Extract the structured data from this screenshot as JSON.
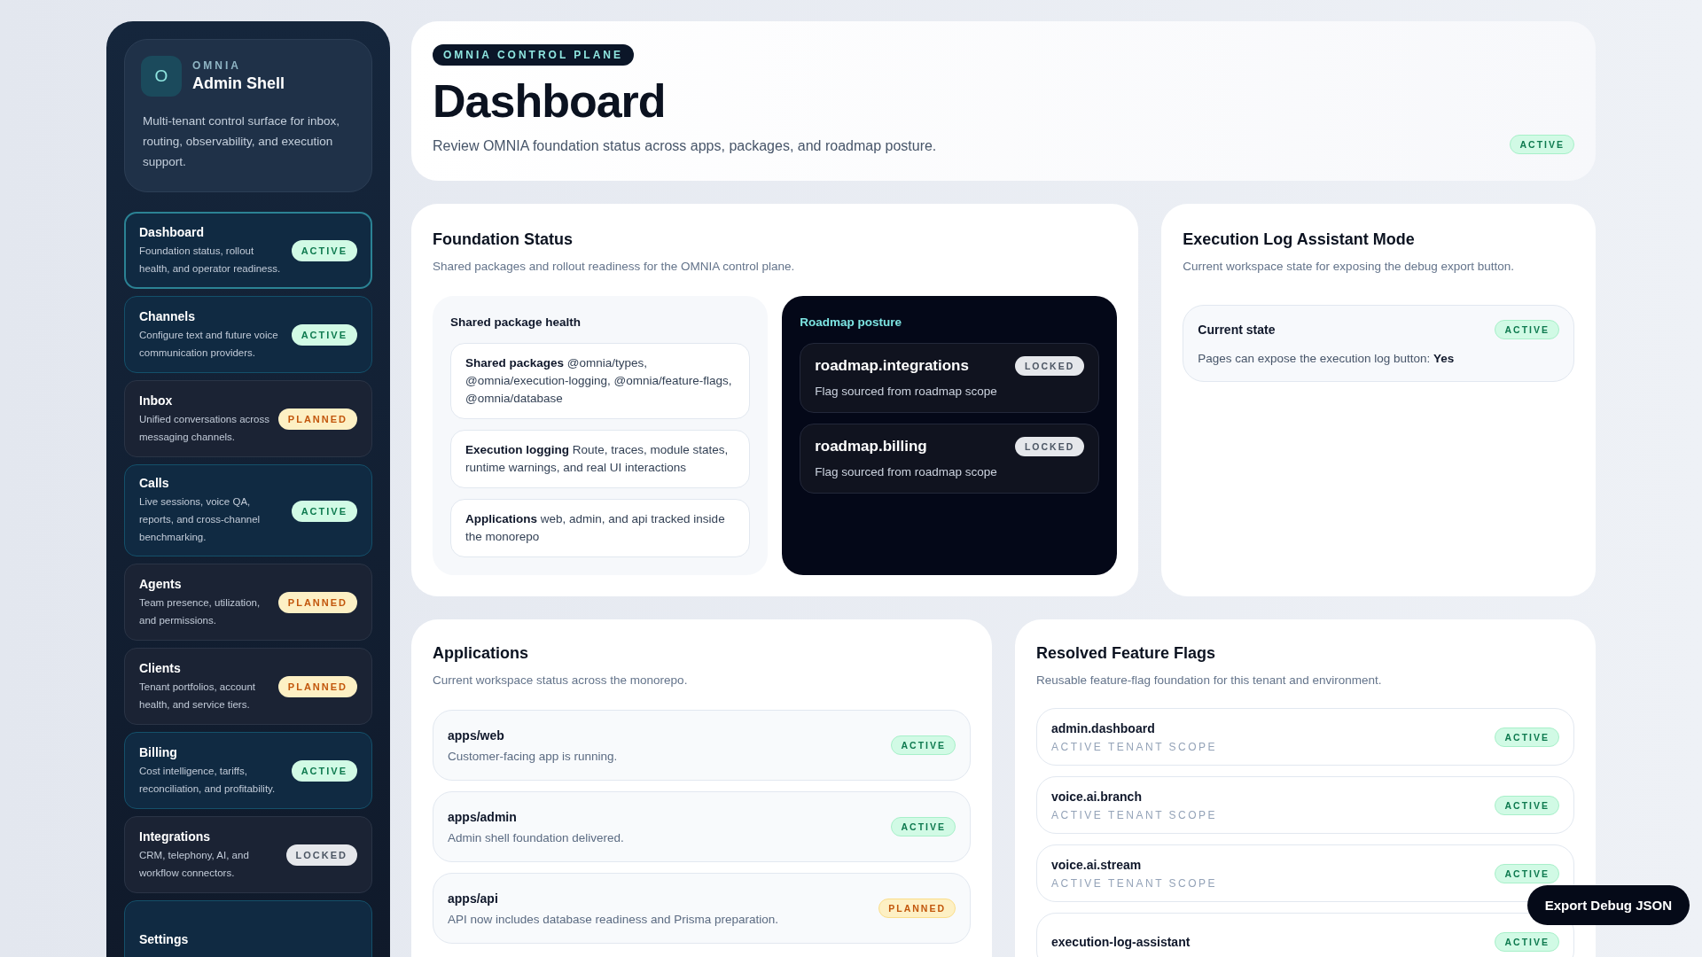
{
  "sidebar": {
    "brand": {
      "logo_letter": "O",
      "eyebrow": "OMNIA",
      "title": "Admin Shell",
      "description": "Multi-tenant control surface for inbox, routing, observability, and execution support."
    },
    "items": [
      {
        "label": "Dashboard",
        "description": "Foundation status, rollout health, and operator readiness.",
        "status": "ACTIVE",
        "kind": "active",
        "selected": true
      },
      {
        "label": "Channels",
        "description": "Configure text and future voice communication providers.",
        "status": "ACTIVE",
        "kind": "active",
        "selected": false
      },
      {
        "label": "Inbox",
        "description": "Unified conversations across messaging channels.",
        "status": "PLANNED",
        "kind": "planned",
        "selected": false
      },
      {
        "label": "Calls",
        "description": "Live sessions, voice QA, reports, and cross-channel benchmarking.",
        "status": "ACTIVE",
        "kind": "active",
        "selected": false
      },
      {
        "label": "Agents",
        "description": "Team presence, utilization, and permissions.",
        "status": "PLANNED",
        "kind": "planned",
        "selected": false
      },
      {
        "label": "Clients",
        "description": "Tenant portfolios, account health, and service tiers.",
        "status": "PLANNED",
        "kind": "planned",
        "selected": false
      },
      {
        "label": "Billing",
        "description": "Cost intelligence, tariffs, reconciliation, and profitability.",
        "status": "ACTIVE",
        "kind": "active",
        "selected": false
      },
      {
        "label": "Integrations",
        "description": "CRM, telephony, AI, and workflow connectors.",
        "status": "LOCKED",
        "kind": "locked",
        "selected": false
      },
      {
        "label": "Settings",
        "kind": "active",
        "selected": false
      }
    ]
  },
  "header": {
    "eyebrow": "OMNIA CONTROL PLANE",
    "title": "Dashboard",
    "subtitle": "Review OMNIA foundation status across apps, packages, and roadmap posture.",
    "status": "ACTIVE",
    "kind": "active"
  },
  "foundation": {
    "title": "Foundation Status",
    "subtitle": "Shared packages and rollout readiness for the OMNIA control plane.",
    "package_health": {
      "title": "Shared package health",
      "items": [
        "**Shared packages** @omnia/types, @omnia/execution-logging, @omnia/feature-flags, @omnia/database",
        "**Execution logging** Route, traces, module states, runtime warnings, and real UI interactions",
        "**Applications** web, admin, and api tracked inside the monorepo"
      ]
    },
    "roadmap": {
      "title": "Roadmap posture",
      "items": [
        {
          "name": "roadmap.integrations",
          "description": "Flag sourced from roadmap scope",
          "status": "LOCKED",
          "kind": "locked"
        },
        {
          "name": "roadmap.billing",
          "description": "Flag sourced from roadmap scope",
          "status": "LOCKED",
          "kind": "locked"
        }
      ]
    }
  },
  "execution_log": {
    "title": "Execution Log Assistant Mode",
    "subtitle": "Current workspace state for exposing the debug export button.",
    "state_label": "Current state",
    "status": "ACTIVE",
    "kind": "active",
    "detail": "Pages can expose the execution log button: **Yes**"
  },
  "applications": {
    "title": "Applications",
    "subtitle": "Current workspace status across the monorepo.",
    "items": [
      {
        "name": "apps/web",
        "description": "Customer-facing app is running.",
        "status": "ACTIVE",
        "kind": "active"
      },
      {
        "name": "apps/admin",
        "description": "Admin shell foundation delivered.",
        "status": "ACTIVE",
        "kind": "active"
      },
      {
        "name": "apps/api",
        "description": "API now includes database readiness and Prisma preparation.",
        "status": "PLANNED",
        "kind": "planned"
      }
    ]
  },
  "feature_flags": {
    "title": "Resolved Feature Flags",
    "subtitle": "Reusable feature-flag foundation for this tenant and environment.",
    "items": [
      {
        "name": "admin.dashboard",
        "scope": "ACTIVE TENANT SCOPE",
        "status": "ACTIVE",
        "kind": "active"
      },
      {
        "name": "voice.ai.branch",
        "scope": "ACTIVE TENANT SCOPE",
        "status": "ACTIVE",
        "kind": "active"
      },
      {
        "name": "voice.ai.stream",
        "scope": "ACTIVE TENANT SCOPE",
        "status": "ACTIVE",
        "kind": "active"
      },
      {
        "name": "execution-log-assistant",
        "status": "ACTIVE",
        "kind": "active"
      }
    ]
  },
  "export_button": "Export Debug JSON"
}
